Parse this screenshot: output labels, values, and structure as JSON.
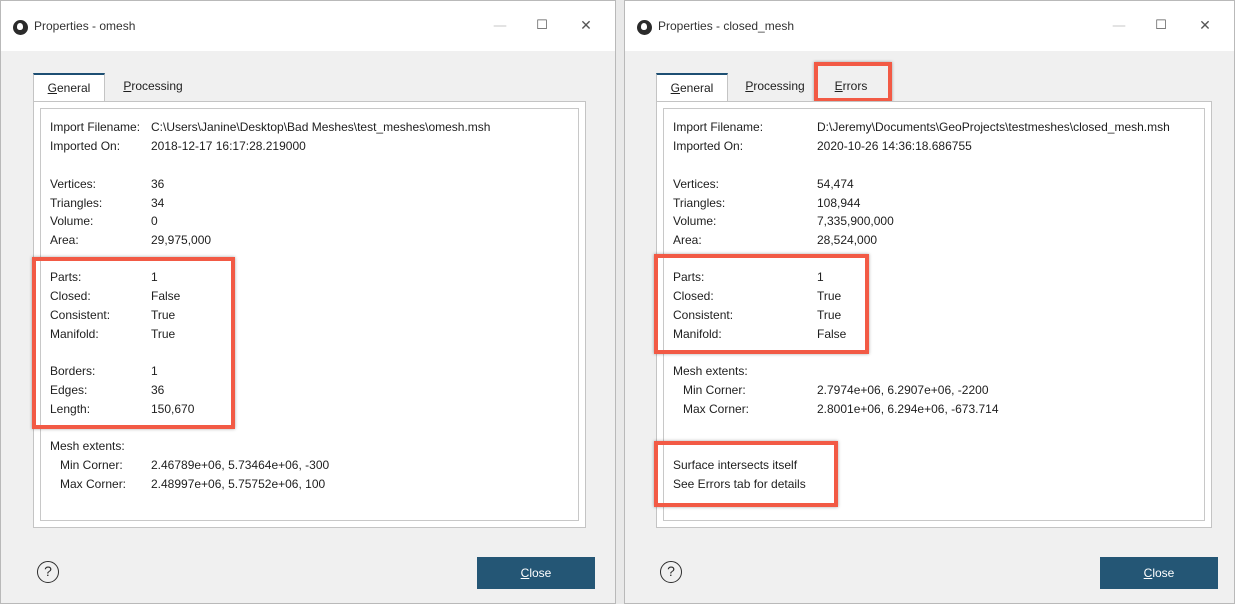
{
  "left": {
    "title": "Properties - omesh",
    "window_controls": {
      "minimize": "—",
      "maximize": "☐",
      "close": "✕"
    },
    "tabs": [
      {
        "mn": "G",
        "rest": "eneral"
      },
      {
        "mn": "P",
        "rest": "rocessing"
      }
    ],
    "import_label": "Import Filename:",
    "import_value": "C:\\Users\\Janine\\Desktop\\Bad Meshes\\test_meshes\\omesh.msh",
    "imported_on_label": "Imported On:",
    "imported_on_value": "2018-12-17 16:17:28.219000",
    "props": [
      {
        "label": "Vertices:",
        "value": "36"
      },
      {
        "label": "Triangles:",
        "value": "34"
      },
      {
        "label": "Volume:",
        "value": "0"
      },
      {
        "label": "Area:",
        "value": "29,975,000"
      },
      {
        "label": "Parts:",
        "value": "1"
      },
      {
        "label": "Closed:",
        "value": "False"
      },
      {
        "label": "Consistent:",
        "value": "True"
      },
      {
        "label": "Manifold:",
        "value": "True"
      },
      {
        "label": "Borders:",
        "value": "1"
      },
      {
        "label": "Edges:",
        "value": "36"
      },
      {
        "label": "Length:",
        "value": "150,670"
      }
    ],
    "mesh_extents_label": "Mesh extents:",
    "min_corner_label": "Min Corner:",
    "min_corner_value": "2.46789e+06, 5.73464e+06, -300",
    "max_corner_label": "Max Corner:",
    "max_corner_value": "2.48997e+06, 5.75752e+06, 100",
    "help": "?",
    "close": {
      "mn": "C",
      "rest": "lose"
    }
  },
  "right": {
    "title": "Properties - closed_mesh",
    "window_controls": {
      "minimize": "—",
      "maximize": "☐",
      "close": "✕"
    },
    "tabs": [
      {
        "mn": "G",
        "rest": "eneral"
      },
      {
        "mn": "P",
        "rest": "rocessing"
      },
      {
        "mn": "E",
        "rest": "rrors"
      }
    ],
    "import_label": "Import Filename:",
    "import_value": "D:\\Jeremy\\Documents\\GeoProjects\\testmeshes\\closed_mesh.msh",
    "imported_on_label": "Imported On:",
    "imported_on_value": "2020-10-26 14:36:18.686755",
    "props": [
      {
        "label": "Vertices:",
        "value": "54,474"
      },
      {
        "label": "Triangles:",
        "value": "108,944"
      },
      {
        "label": "Volume:",
        "value": "7,335,900,000"
      },
      {
        "label": "Area:",
        "value": "28,524,000"
      },
      {
        "label": "Parts:",
        "value": "1"
      },
      {
        "label": "Closed:",
        "value": "True"
      },
      {
        "label": "Consistent:",
        "value": "True"
      },
      {
        "label": "Manifold:",
        "value": "False"
      }
    ],
    "mesh_extents_label": "Mesh extents:",
    "min_corner_label": "Min Corner:",
    "min_corner_value": "2.7974e+06, 6.2907e+06, -2200",
    "max_corner_label": "Max Corner:",
    "max_corner_value": "2.8001e+06, 6.294e+06, -673.714",
    "error_line_1": "Surface intersects itself",
    "error_line_2": "See Errors tab for details",
    "help": "?",
    "close": {
      "mn": "C",
      "rest": "lose"
    }
  },
  "annotation_color": "#f25a45",
  "button_color": "#245675"
}
